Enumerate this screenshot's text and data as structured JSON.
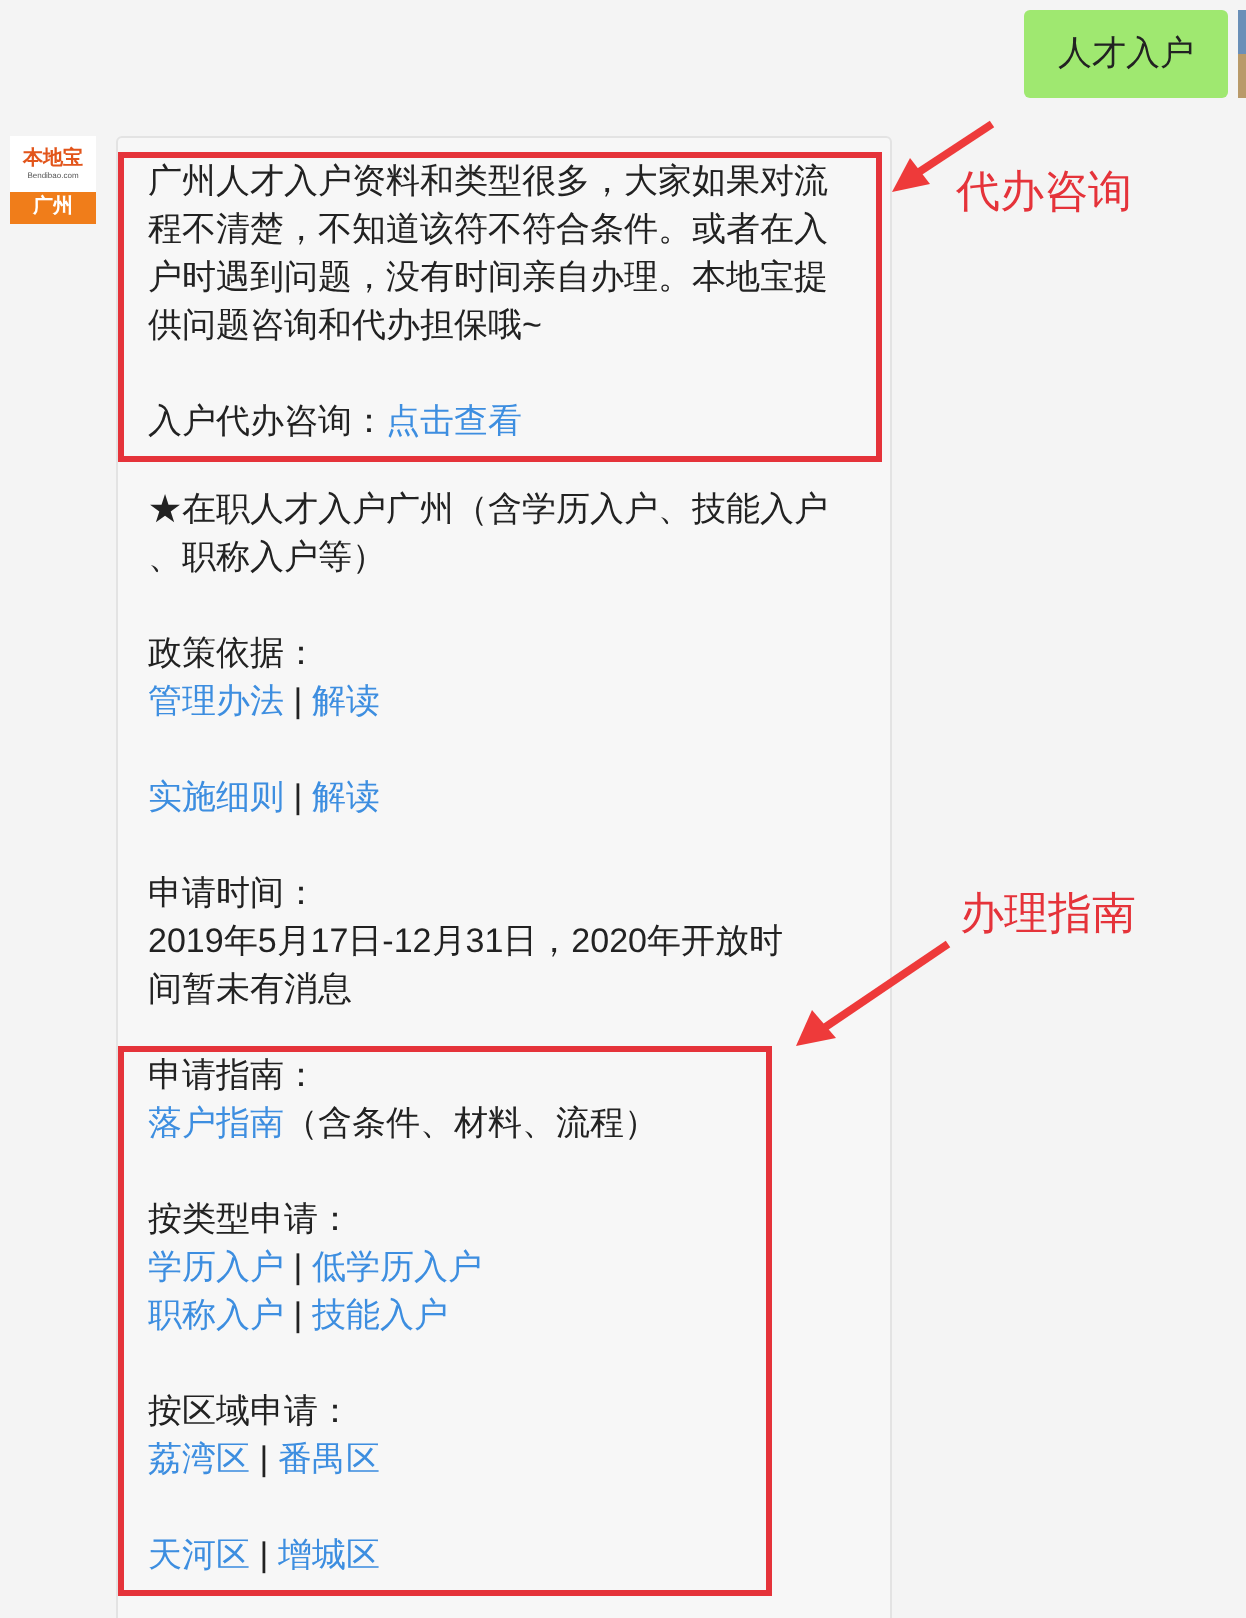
{
  "outgoing_message": {
    "text": "人才入户"
  },
  "sender_avatar": {
    "logo": "本地宝",
    "site": "Bendibao.com",
    "city": "广州"
  },
  "message": {
    "blocks": [
      {
        "highlighted": true,
        "paragraphs": [
          [
            [
              {
                "kind": "text",
                "text": "广州人才入户资料和类型很多，大家如果对流"
              }
            ],
            [
              {
                "kind": "text",
                "text": "程不清楚，不知道该符不符合条件。或者在入"
              }
            ],
            [
              {
                "kind": "text",
                "text": "户时遇到问题，没有时间亲自办理。本地宝提"
              }
            ],
            [
              {
                "kind": "text",
                "text": "供问题咨询和代办担保哦~"
              }
            ]
          ],
          [
            [
              {
                "kind": "text",
                "text": "入户代办咨询："
              },
              {
                "kind": "link",
                "text": "点击查看"
              }
            ]
          ]
        ]
      },
      {
        "highlighted": false,
        "paragraphs": [
          [
            [
              {
                "kind": "text",
                "text": "★在职人才入户广州（含学历入户、技能入户"
              }
            ],
            [
              {
                "kind": "text",
                "text": "、职称入户等）"
              }
            ]
          ],
          [
            [
              {
                "kind": "text",
                "text": "政策依据："
              }
            ],
            [
              {
                "kind": "link",
                "text": "管理办法"
              },
              {
                "kind": "text",
                "text": " | "
              },
              {
                "kind": "link",
                "text": "解读"
              }
            ]
          ],
          [
            [
              {
                "kind": "link",
                "text": "实施细则"
              },
              {
                "kind": "text",
                "text": " | "
              },
              {
                "kind": "link",
                "text": "解读"
              }
            ]
          ],
          [
            [
              {
                "kind": "text",
                "text": "申请时间："
              }
            ],
            [
              {
                "kind": "text",
                "text": "2019年5月17日-12月31日，2020年开放时"
              }
            ],
            [
              {
                "kind": "text",
                "text": "间暂未有消息"
              }
            ]
          ]
        ]
      },
      {
        "highlighted": true,
        "paragraphs": [
          [
            [
              {
                "kind": "text",
                "text": "申请指南："
              }
            ],
            [
              {
                "kind": "link",
                "text": "落户指南"
              },
              {
                "kind": "text",
                "text": "（含条件、材料、流程）"
              }
            ]
          ],
          [
            [
              {
                "kind": "text",
                "text": "按类型申请："
              }
            ],
            [
              {
                "kind": "link",
                "text": "学历入户"
              },
              {
                "kind": "text",
                "text": " | "
              },
              {
                "kind": "link",
                "text": "低学历入户"
              }
            ],
            [
              {
                "kind": "link",
                "text": "职称入户"
              },
              {
                "kind": "text",
                "text": " | "
              },
              {
                "kind": "link",
                "text": "技能入户"
              }
            ]
          ],
          [
            [
              {
                "kind": "text",
                "text": "按区域申请："
              }
            ],
            [
              {
                "kind": "link",
                "text": "荔湾区"
              },
              {
                "kind": "text",
                "text": " | "
              },
              {
                "kind": "link",
                "text": "番禺区"
              }
            ]
          ],
          [
            [
              {
                "kind": "link",
                "text": "天河区"
              },
              {
                "kind": "text",
                "text": " | "
              },
              {
                "kind": "link",
                "text": "增城区"
              }
            ]
          ]
        ]
      }
    ]
  },
  "annotations": [
    {
      "text": "代办咨询"
    },
    {
      "text": "办理指南"
    }
  ]
}
